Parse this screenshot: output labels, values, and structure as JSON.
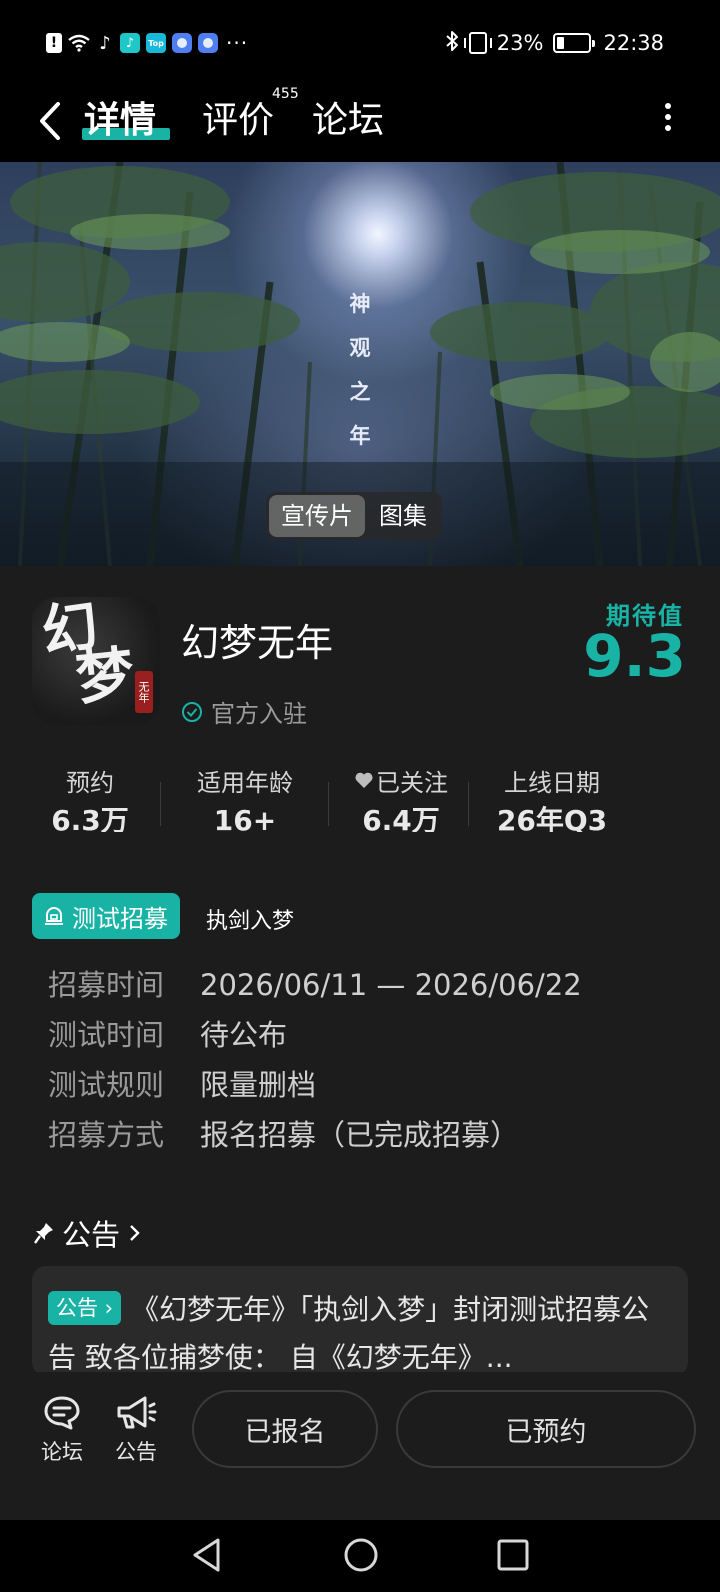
{
  "status_bar": {
    "app_icons": [
      "alert-icon",
      "wifi-icon",
      "tiktok-icon",
      "tiktok-lite-icon",
      "top-icon",
      "browser-icon",
      "browser2-icon"
    ],
    "top_badge": "Top",
    "more": "···",
    "battery": "23%",
    "battery_level": 0.23,
    "time": "22:38"
  },
  "header": {
    "tabs": [
      {
        "label": "详情",
        "active": true
      },
      {
        "label": "评价",
        "badge": "455"
      },
      {
        "label": "论坛"
      }
    ]
  },
  "banner": {
    "title_vertical": "神观之年",
    "media_tabs": [
      {
        "label": "宣传片",
        "active": true
      },
      {
        "label": "图集"
      }
    ]
  },
  "game": {
    "icon_text": "幻梦",
    "icon_seal": "无年",
    "name": "幻梦无年",
    "official_label": "官方入驻",
    "expect_label": "期待值",
    "expect_score": "9.3",
    "accent_color": "#19b3a6"
  },
  "stats": [
    {
      "label": "预约",
      "value": "6.3万"
    },
    {
      "label": "适用年龄",
      "value": "16+"
    },
    {
      "label": "已关注",
      "value": "6.4万"
    },
    {
      "label": "上线日期",
      "value": "26年Q3"
    }
  ],
  "recruit": {
    "tag": "测试招募",
    "name": "执剑入梦",
    "rows": [
      {
        "key": "招募时间",
        "value": "2026/06/11 — 2026/06/22"
      },
      {
        "key": "测试时间",
        "value": "待公布"
      },
      {
        "key": "测试规则",
        "value": "限量删档"
      },
      {
        "key": "招募方式",
        "value": "报名招募（已完成招募）"
      }
    ]
  },
  "notice": {
    "heading": "公告",
    "tag": "公告",
    "text": "《幻梦无年》「执剑入梦」封闭测试招募公告 致各位捕梦使：  自《幻梦无年》..."
  },
  "actions": {
    "forum_label": "论坛",
    "announce_label": "公告",
    "registered_label": "已报名",
    "reserved_label": "已预约"
  }
}
